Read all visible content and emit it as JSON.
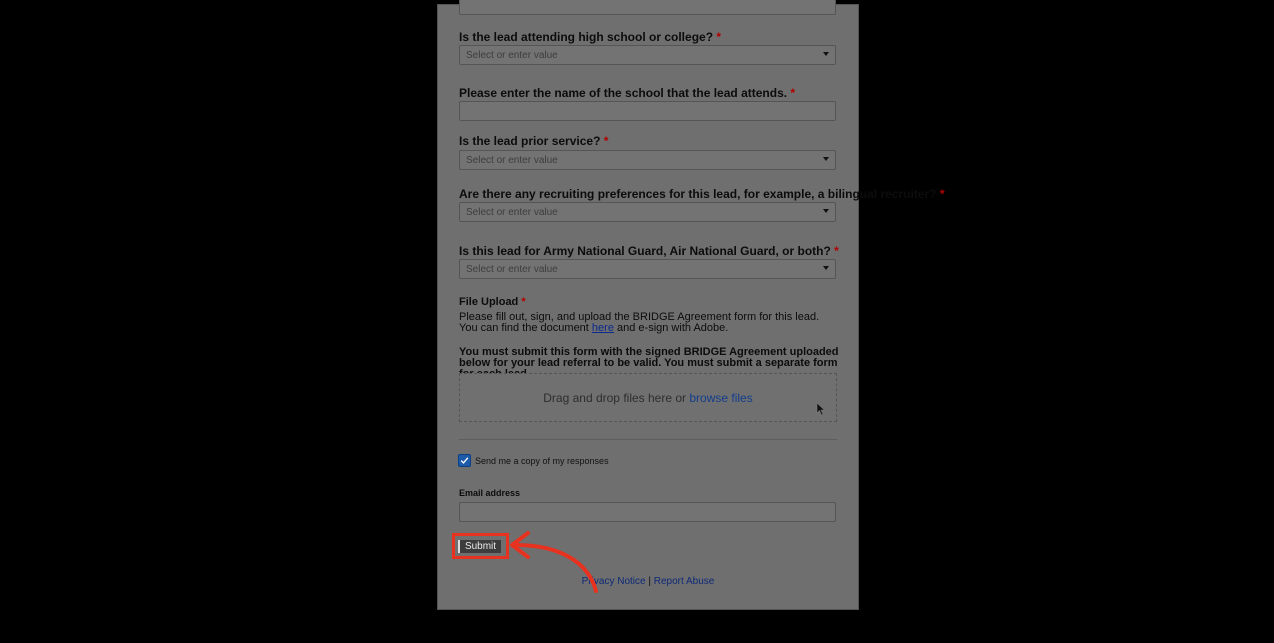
{
  "form": {
    "q_school_level": {
      "label": "Is the lead attending high school or college?",
      "required_mark": "*",
      "placeholder": "Select or enter value"
    },
    "q_school_name": {
      "label": "Please enter the name of the school that the lead attends.",
      "required_mark": "*"
    },
    "q_prior_service": {
      "label": "Is the lead prior service?",
      "required_mark": "*",
      "placeholder": "Select or enter value"
    },
    "q_recruiting_pref": {
      "label": "Are there any recruiting preferences for this lead, for example, a bilingual recruiter?",
      "required_mark": "*",
      "placeholder": "Select or enter value"
    },
    "q_guard_type": {
      "label": "Is this lead for Army National Guard, Air National Guard, or both?",
      "required_mark": "*",
      "placeholder": "Select or enter value"
    },
    "file_upload": {
      "label": "File Upload",
      "required_mark": "*",
      "instructions_before_link": "Please fill out, sign, and upload the BRIDGE Agreement form for this lead. You can find the document ",
      "link_text": "here",
      "instructions_after_link": " and e-sign with Adobe.",
      "notice": "You must submit this form with the signed BRIDGE Agreement uploaded below for your lead referral to be valid. You must submit a separate form for each lead.",
      "dropzone_text": "Drag and drop files here or ",
      "browse_text": "browse files"
    },
    "send_copy": {
      "label": "Send me a copy of my responses",
      "checked": true
    },
    "email": {
      "label": "Email address",
      "value": ""
    },
    "submit_label": "Submit"
  },
  "footer": {
    "privacy": "Privacy Notice",
    "separator": "|",
    "report": "Report Abuse"
  },
  "colors": {
    "annotation": "#e6321f",
    "checkbox": "#1d5aa8",
    "required": "#b30000"
  },
  "icons": {
    "cursor": "mouse-pointer-icon",
    "arrow": "curved-arrow-icon",
    "check": "checkmark-icon",
    "caret": "chevron-down-icon"
  }
}
